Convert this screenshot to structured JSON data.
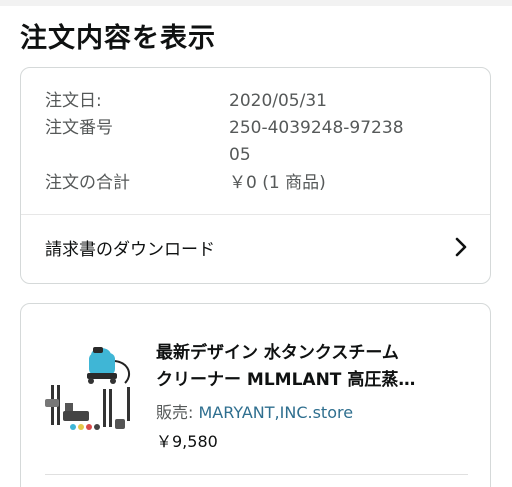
{
  "page_title": "注文内容を表示",
  "summary": {
    "order_date_label": "注文日:",
    "order_date_value": "2020/05/31",
    "order_number_label": "注文番号",
    "order_number_value": "250-4039248-9723805",
    "order_total_label": "注文の合計",
    "order_total_value": "￥0 (1 商品)",
    "invoice_link": "請求書のダウンロード",
    "invoice_icon": "chevron-right-icon"
  },
  "item": {
    "title_line1": "最新デザイン 水タンクスチーム",
    "title_line2": "クリーナー MLMLANT 高圧蒸…",
    "seller_label": "販売: ",
    "seller_name": "MARYANT,INC.store",
    "price": "￥9,580",
    "image_icon": "steam-cleaner-product-image"
  },
  "colors": {
    "link": "#2f6f8f",
    "border": "#d5d9d9",
    "secondary_text": "#565959",
    "product_accent": "#3fb6d6"
  }
}
